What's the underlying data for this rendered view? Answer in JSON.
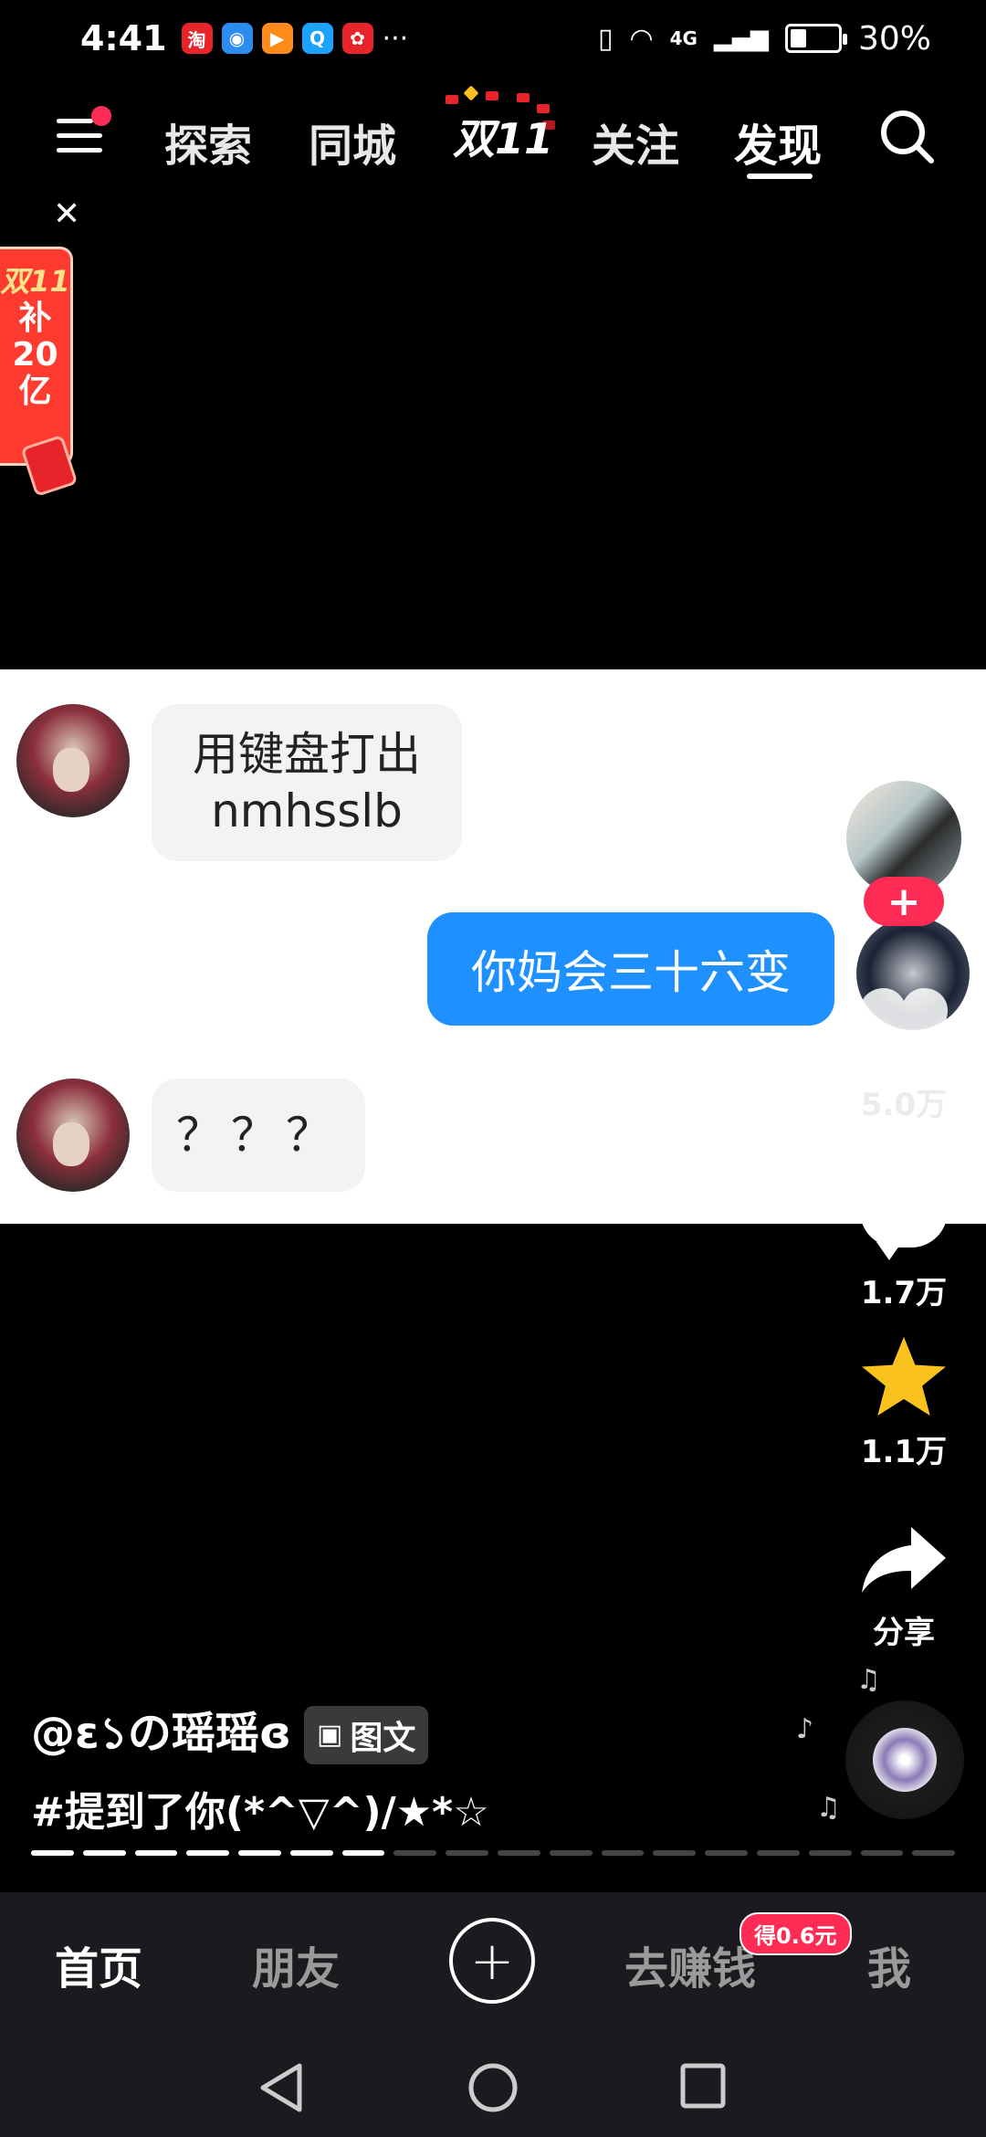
{
  "status_bar": {
    "time": "4:41",
    "app_icons": [
      "taobao-icon",
      "browser-icon",
      "video-icon",
      "search-app-icon",
      "shopping-festival-icon"
    ],
    "more": "···",
    "network": "4G",
    "battery_percent": "30%",
    "battery_level": 0.3
  },
  "top_nav": {
    "tabs": [
      "探索",
      "同城",
      "关注",
      "发现"
    ],
    "active_tab": "发现",
    "promo_label": "双11"
  },
  "side_promo": {
    "line1": "双11",
    "line2": "补",
    "line3": "20",
    "line4": "亿"
  },
  "chat": {
    "msg1": "用键盘打出\nnmhsslb",
    "msg2": "你妈会三十六变",
    "msg3": "？？？"
  },
  "actions": {
    "like_count": "5.0万",
    "comment_count": "1.7万",
    "favorite_count": "1.1万",
    "share_label": "分享"
  },
  "caption": {
    "username": "@ɛ১の瑶瑶ɞ",
    "tag": "图文",
    "text": "#提到了你(*^▽^)/★*☆"
  },
  "progress": {
    "total_segments": 18,
    "completed_segments": 7
  },
  "bottom_tabs": {
    "home": "首页",
    "friends": "朋友",
    "earn": "去赚钱",
    "me": "我",
    "earn_badge": "得0.6元"
  },
  "colors": {
    "accent_red": "#fe2c55",
    "chat_blue": "#1e90ff",
    "star_yellow": "#f9c21e"
  }
}
